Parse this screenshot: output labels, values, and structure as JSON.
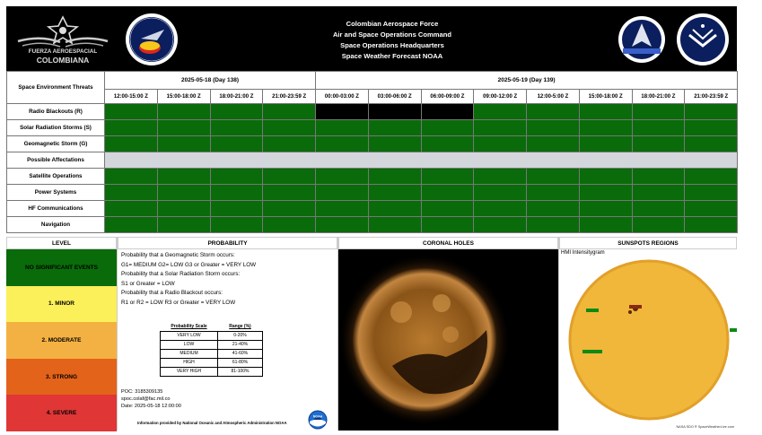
{
  "header": {
    "line1": "Colombian Aerospace Force",
    "line2": "Air and Space Operations Command",
    "line3": "Space Operations Headquarters",
    "line4": "Space Weather Forecast NOAA",
    "logo_left_text1": "FUERZA AEROESPACIAL",
    "logo_left_text2": "COLOMBIANA"
  },
  "grid": {
    "corner_label": "Space Environment Threats",
    "date1": "2025-05-18 (Day 138)",
    "date2": "2025-05-19 (Day 139)",
    "slots": [
      "12:00-15:00 Z",
      "15:00-18:00 Z",
      "18:00-21:00 Z",
      "21:00-23:59 Z",
      "00:00-03:00 Z",
      "03:00-06:00 Z",
      "06:00-09:00 Z",
      "09:00-12:00 Z",
      "12:00-5:00 Z",
      "15:00-18:00 Z",
      "18:00-21:00 Z",
      "21:00-23:59 Z"
    ],
    "threats": [
      {
        "label": "Radio Blackouts (R)",
        "cells": [
          "g",
          "g",
          "g",
          "g",
          "blk",
          "blk",
          "blk",
          "g",
          "g",
          "g",
          "g",
          "g"
        ]
      },
      {
        "label": "Solar Radiation Storms (S)",
        "cells": [
          "g",
          "g",
          "g",
          "g",
          "g",
          "g",
          "g",
          "g",
          "g",
          "g",
          "g",
          "g"
        ]
      },
      {
        "label": "Geomagnetic Storm (G)",
        "cells": [
          "g",
          "g",
          "g",
          "g",
          "g",
          "g",
          "g",
          "g",
          "g",
          "g",
          "g",
          "g"
        ]
      }
    ],
    "affect_label": "Possible Affectations",
    "affectations": [
      {
        "label": "Satellite Operations"
      },
      {
        "label": "Power Systems"
      },
      {
        "label": "HF Communications"
      },
      {
        "label": "Navigation"
      }
    ]
  },
  "level": {
    "header": "LEVEL",
    "items": [
      {
        "label": "NO SIGNIFICANT EVENTS",
        "color": "#0a6b0a"
      },
      {
        "label": "1. MINOR",
        "color": "#fbf05a"
      },
      {
        "label": "2. MODERATE",
        "color": "#f4b143"
      },
      {
        "label": "3. STRONG",
        "color": "#e3631a"
      },
      {
        "label": "4. SEVERE",
        "color": "#e03636"
      }
    ]
  },
  "probability": {
    "header": "PROBABILITY",
    "lines": [
      "Probability that a Geomagnetic Storm occurs:",
      "G1= MEDIUM G2= LOW G3 or Greater = VERY LOW",
      "Probability that a Solar Radiation Storm occurs:",
      "S1 or Greater = LOW",
      "Probability that a Radio Blackout occurs:",
      "R1 or R2 = LOW R3 or Greater = VERY LOW"
    ],
    "scale_header": "Probability Scale",
    "range_header": "Range (%)",
    "scale": [
      {
        "name": "VERY LOW",
        "range": "0-20%"
      },
      {
        "name": "LOW",
        "range": "21-40%"
      },
      {
        "name": "MEDIUM",
        "range": "41-60%"
      },
      {
        "name": "HIGH",
        "range": "61-80%"
      },
      {
        "name": "VERY HIGH",
        "range": "81-100%"
      }
    ],
    "poc": "POC: 3185309135",
    "email": "spoc.colaf@fac.mil.co",
    "date": "Date: 2025-05-18 12:00:00",
    "footer": "Information provided by National Oceanic and Atmospheric Administration NOAA",
    "noaa_logo_text": "NOAA"
  },
  "coronal": {
    "header": "CORONAL HOLES"
  },
  "sunspots": {
    "header": "SUNSPOTS REGIONS",
    "image_title": "HMI Intensitygram",
    "credit": "NASA SDO ® SpaceWeatherLive.com"
  },
  "colors": {
    "green": "#0a6b0a",
    "gray": "#d3d6da"
  }
}
